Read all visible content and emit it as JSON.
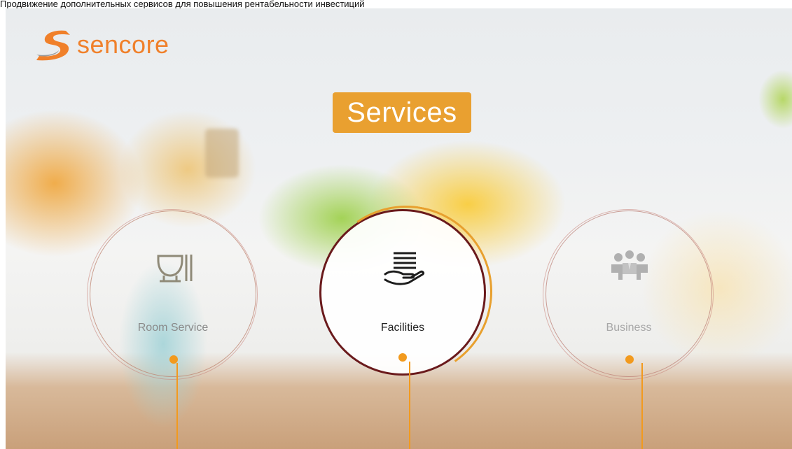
{
  "caption": "Продвижение дополнительных сервисов для повышения рентабельности инвестиций",
  "brand": {
    "name": "sencore",
    "color": "#f0802a"
  },
  "title": "Services",
  "accent_color": "#e9a030",
  "services": [
    {
      "label": "Room Service",
      "icon": "dinner-bell-cloche-icon",
      "state": "inactive"
    },
    {
      "label": "Facilities",
      "icon": "serving-hand-icon",
      "state": "selected"
    },
    {
      "label": "Business",
      "icon": "business-meeting-people-icon",
      "state": "inactive"
    }
  ]
}
